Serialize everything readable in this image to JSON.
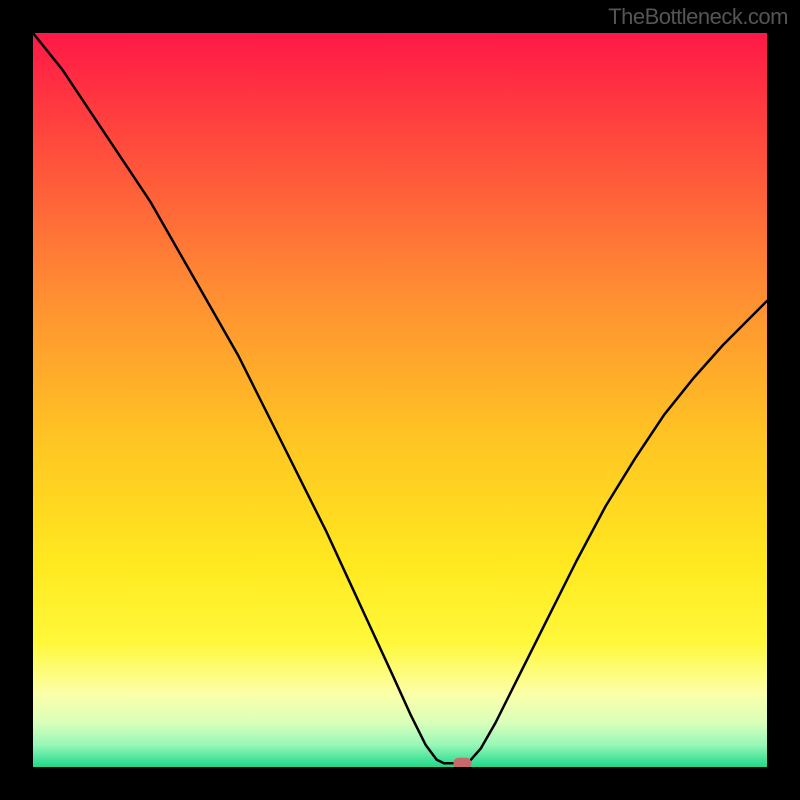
{
  "watermark": "TheBottleneck.com",
  "chart_data": {
    "type": "line",
    "xlim": [
      0,
      100
    ],
    "ylim": [
      0,
      100
    ],
    "curve": [
      {
        "x": 0,
        "y": 100
      },
      {
        "x": 4,
        "y": 95
      },
      {
        "x": 8,
        "y": 89
      },
      {
        "x": 12,
        "y": 83
      },
      {
        "x": 16,
        "y": 77
      },
      {
        "x": 20,
        "y": 70
      },
      {
        "x": 24,
        "y": 63
      },
      {
        "x": 28,
        "y": 56
      },
      {
        "x": 31,
        "y": 50
      },
      {
        "x": 34,
        "y": 44
      },
      {
        "x": 37,
        "y": 38
      },
      {
        "x": 40,
        "y": 32
      },
      {
        "x": 43,
        "y": 25.5
      },
      {
        "x": 46,
        "y": 19
      },
      {
        "x": 49,
        "y": 12.5
      },
      {
        "x": 51.5,
        "y": 7
      },
      {
        "x": 53.5,
        "y": 3
      },
      {
        "x": 55,
        "y": 1
      },
      {
        "x": 56,
        "y": 0.5
      },
      {
        "x": 57,
        "y": 0.5
      },
      {
        "x": 58,
        "y": 0.5
      },
      {
        "x": 59.5,
        "y": 0.8
      },
      {
        "x": 61,
        "y": 2.5
      },
      {
        "x": 63,
        "y": 6
      },
      {
        "x": 66,
        "y": 12
      },
      {
        "x": 70,
        "y": 20
      },
      {
        "x": 74,
        "y": 28
      },
      {
        "x": 78,
        "y": 35.5
      },
      {
        "x": 82,
        "y": 42
      },
      {
        "x": 86,
        "y": 48
      },
      {
        "x": 90,
        "y": 53
      },
      {
        "x": 94,
        "y": 57.5
      },
      {
        "x": 98,
        "y": 61.5
      },
      {
        "x": 100,
        "y": 63.5
      }
    ],
    "marker": {
      "x": 58.5,
      "y": 0.5,
      "color": "#c76a6a"
    },
    "gradient_stops": [
      {
        "offset": 0,
        "color": "#ff1846"
      },
      {
        "offset": 0.15,
        "color": "#ff4a3d"
      },
      {
        "offset": 0.35,
        "color": "#ff8c33"
      },
      {
        "offset": 0.55,
        "color": "#ffc423"
      },
      {
        "offset": 0.72,
        "color": "#ffe81f"
      },
      {
        "offset": 0.83,
        "color": "#fff83a"
      },
      {
        "offset": 0.9,
        "color": "#fcffa8"
      },
      {
        "offset": 0.94,
        "color": "#d9ffbb"
      },
      {
        "offset": 0.97,
        "color": "#97f7b8"
      },
      {
        "offset": 1.0,
        "color": "#1fd88a"
      }
    ]
  }
}
